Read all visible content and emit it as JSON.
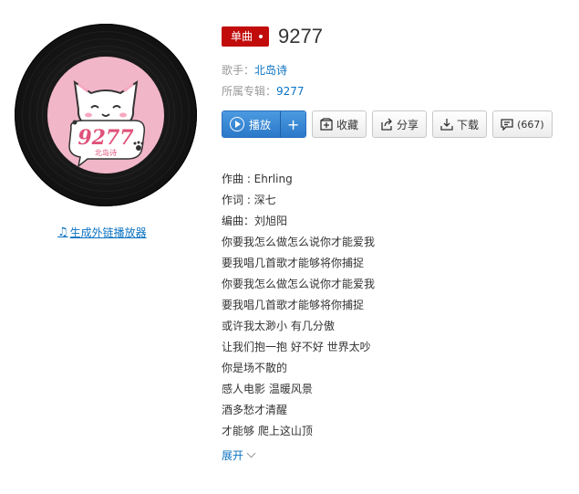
{
  "cover": {
    "label_text_big": "9277",
    "label_text_small": "北岛诗"
  },
  "external_player_link": "生成外链播放器",
  "song": {
    "tag": "单曲",
    "title": "9277",
    "singer_label": "歌手：",
    "singer": "北岛诗",
    "album_label": "所属专辑：",
    "album": "9277"
  },
  "actions": {
    "play": "播放",
    "add": "+",
    "collect": "收藏",
    "share": "分享",
    "download": "下载",
    "comment_count": "(667)"
  },
  "lyrics": [
    "作曲 : Ehrling",
    "作词 : 深七",
    "编曲：刘旭阳",
    "你要我怎么做怎么说你才能爱我",
    "要我唱几首歌才能够将你捕捉",
    "你要我怎么做怎么说你才能爱我",
    "要我唱几首歌才能够将你捕捉",
    "或许我太渺小 有几分傲",
    "让我们抱一抱 好不好 世界太吵",
    "你是场不散的",
    "感人电影 温暖风景",
    "酒多愁才清醒",
    "才能够 爬上这山顶"
  ],
  "expand_label": "展开",
  "colors": {
    "accent_red": "#c20c0c",
    "link_blue": "#0c73c2",
    "label_pink": "#f2b6c9"
  }
}
